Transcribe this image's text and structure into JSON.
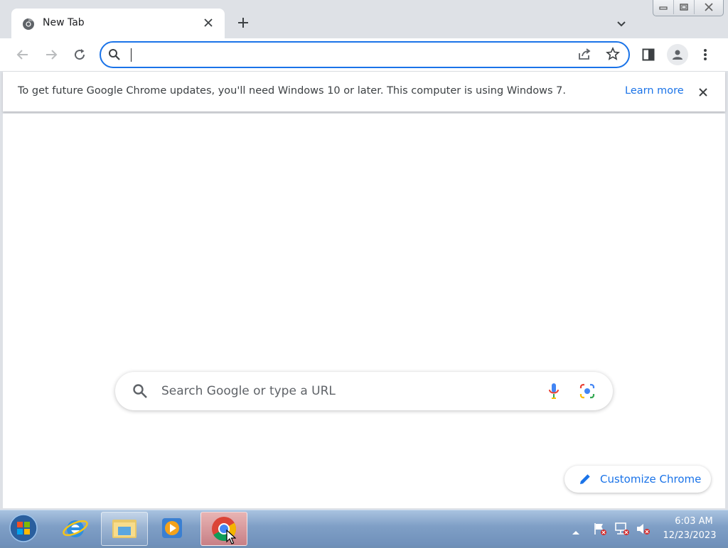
{
  "browser": {
    "tab": {
      "title": "New Tab"
    },
    "omnibox": {
      "value": "",
      "placeholder": ""
    }
  },
  "infobar": {
    "message": "To get future Google Chrome updates, you'll need Windows 10 or later. This computer is using Windows 7.",
    "link": "Learn more"
  },
  "ntp": {
    "search_placeholder": "Search Google or type a URL",
    "customize_label": "Customize Chrome"
  },
  "taskbar": {
    "apps": [
      "start-orb",
      "internet-explorer",
      "windows-explorer",
      "media-player",
      "google-chrome"
    ],
    "clock": {
      "time": "6:03 AM",
      "date": "12/23/2023"
    }
  },
  "colors": {
    "accent": "#1a73e8",
    "tabstrip": "#dee1e6",
    "taskbar": "#7f9fc6"
  }
}
